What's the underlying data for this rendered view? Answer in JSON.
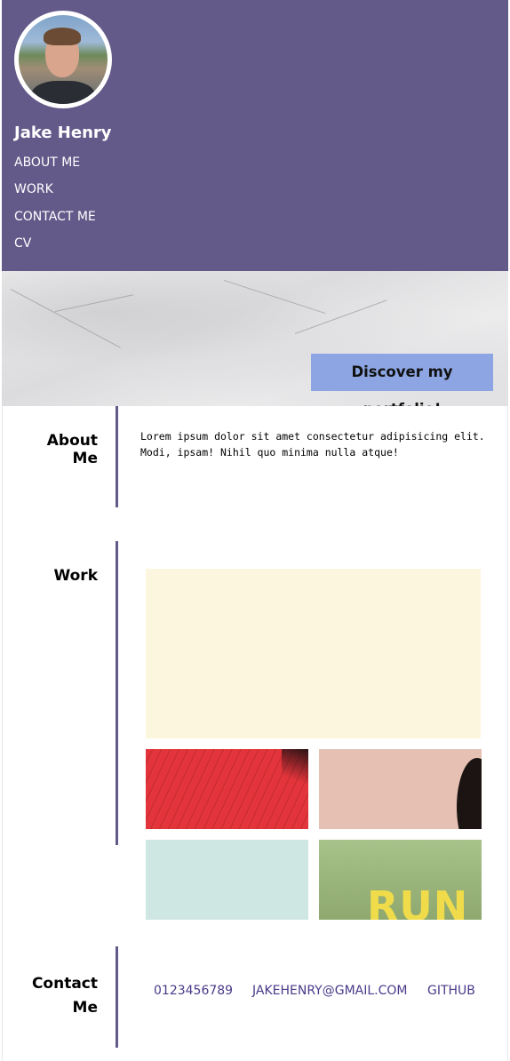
{
  "profile": {
    "name": "Jake Henry",
    "avatar_icon": "profile-photo"
  },
  "nav": {
    "items": [
      "ABOUT ME",
      "WORK",
      "CONTACT ME",
      "CV"
    ]
  },
  "hero": {
    "cta_label": "Discover my portfolio!"
  },
  "about": {
    "title": "About Me",
    "text": "Lorem ipsum dolor sit amet consectetur adipisicing elit. Modi, ipsam! Nihil quo minima nulla atque!"
  },
  "work": {
    "title": "Work",
    "tiles": [
      {
        "label": ""
      },
      {
        "label": ""
      },
      {
        "label": ""
      },
      {
        "label": ""
      },
      {
        "label": "RUN"
      }
    ]
  },
  "contact": {
    "title_line1": "Contact",
    "title_line2": "Me",
    "phone": "0123456789",
    "email": "JAKEHENRY@GMAIL.COM",
    "github": "GITHUB"
  },
  "colors": {
    "header_bg": "#645a8a",
    "accent": "#8da6e3",
    "divider": "#645a8a",
    "link": "#4a3a8a"
  }
}
